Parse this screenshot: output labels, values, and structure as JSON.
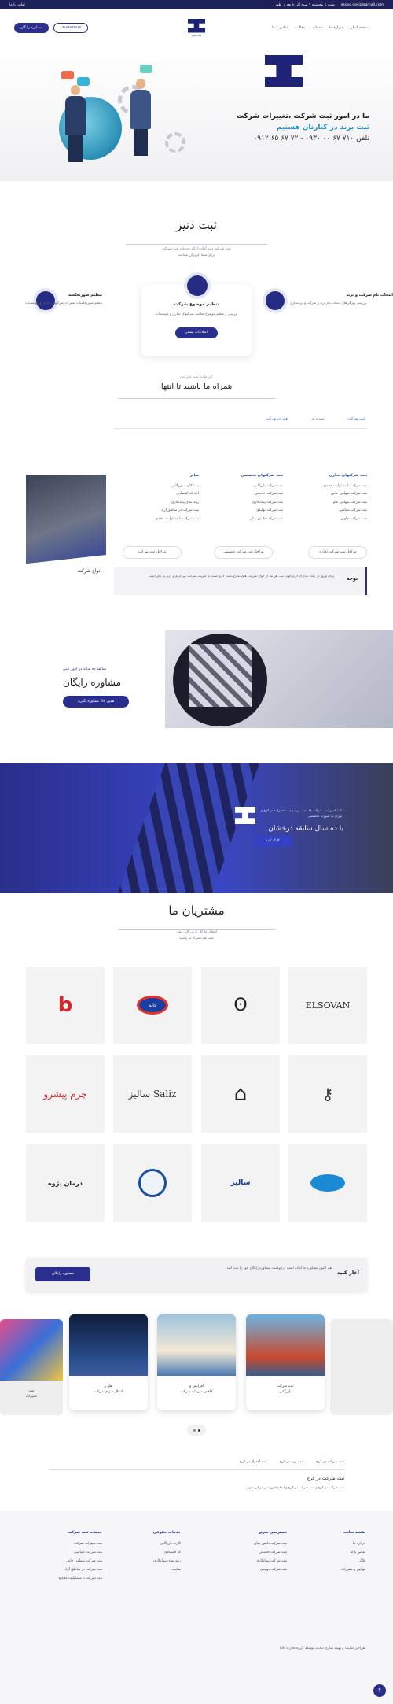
{
  "topbar": {
    "email": "asoyo.desiz@gmail.com",
    "hours": "شنبه تا پنجشنبه ۹ صبح الی ۸ بعد از ظهر",
    "link": "تماس با ما"
  },
  "header": {
    "nav": [
      "صفحه اصلی",
      "درباره ما",
      "خدمات",
      "مقالات",
      "تماس با ما"
    ],
    "logo_text": "ثبت دنیز",
    "phone": "۰۹۱۲۲۷۴۹۲۱۲",
    "consult_btn": "مشاوره رایگان"
  },
  "hero": {
    "line1": "ما در امور ثبت شرکت ،تغییرات شرکت",
    "line2": "ثبت برند در کنارتان هستیم",
    "line3": "تلفن ۷۱۰ ۶۷ ۰۰ ۰۹۳۰ - ۷۲ ۶۷ ۶۵ ۰۹۱۲"
  },
  "about": {
    "title": "ثبت دنیز",
    "sub1": "ثبت شرکت دنیز آماده ارائه خدمات ثبت شرکت",
    "sub2": "برای شما عزیزان میباشد",
    "cards": [
      {
        "title": "انتخاب نام شرکت و برند",
        "text": "بررسی ویژگی‌های انتخاب نام برند و شرکت و برندسازی"
      },
      {
        "title": "تنظیم موضوع شرکت",
        "text": "بررسی و تنظیم موضوع فعالیت شرکتهای تجاری و موسسات"
      },
      {
        "title": "تنظیم صورتجلسه",
        "text": "تنظیم صورتجلسات تغییرات شرکتهای تجاری و موسسات"
      }
    ],
    "more_btn": "اطلاعات بیشتر"
  },
  "services": {
    "kicker": "الزامات ثبت شرکت",
    "title": "همراه ما باشید تا انتها",
    "tabs": [
      "ثبت شرکت",
      "ثبت برند",
      "تغییرات شرکت"
    ],
    "cols": [
      {
        "head": "ثبت شرکتهای تجاری",
        "items": [
          "ثبت شرکت با مسئولیت محدود",
          "ثبت شرکت سهامی خاص",
          "ثبت شرکت سهامی عام",
          "ثبت شرکت تضامنی",
          "ثبت شرکت تعاونی"
        ]
      },
      {
        "head": "ثبت شرکتهای تخصصی",
        "items": [
          "ثبت شرکت بازرگانی",
          "ثبت شرکت خدماتی",
          "ثبت شرکت پیمانکاری",
          "ثبت شرکت تولیدی",
          "ثبت شرکت دانش بنیان"
        ]
      },
      {
        "head": "سایر",
        "items": [
          "ثبت کارت بازرگانی",
          "اخذ کد اقتصادی",
          "رتبه بندی پیمانکاری",
          "ثبت شرکت در مناطق آزاد",
          "ثبت شرکت با مسئولیت محدود"
        ]
      }
    ],
    "pills": [
      "مراحل ثبت شرکت تجاری",
      "مراحل ثبت شرکت تخصصی",
      "مراحل ثبت شرکت"
    ],
    "side_title": "انواع شرکت",
    "note_label": "توجه",
    "note_text": "برای ورود در بحث مدارک لازم جهت ثبت هر یک از انواع شرکت های تجاری،ابتدا لازم است به تعریف شرکت بپردازیم و لازم به ذکر است"
  },
  "consult": {
    "kicker": "سابقه ده ساله در امور ثبتی",
    "title": "مشاوره رایگان",
    "btn": "همین حالا مشاوره بگیرید"
  },
  "banner": {
    "small": "کلیه امور ثبت شرکت ها ، ثبت برند و ثبت تغییرات در کرج و تهران به صورت تخصصی",
    "title": "با ده سال سابقه درخشان",
    "btn": "کلیک کنید"
  },
  "clients": {
    "title": "مشتریان ما",
    "sub1": "افتخار ما کار با بزرگانی مثل",
    "sub2": "شما هم همراه ما باشید",
    "logos": [
      "ELSOVAN",
      "",
      "کاله",
      "",
      "",
      "",
      "Saliz سالیز",
      "چرم پیشرو",
      "",
      "سالیز",
      "",
      "درمان پژوه"
    ]
  },
  "cta": {
    "label": "آغاز کنید",
    "text": "هم اکنون مشاوره ما آماده است درخواست مشاوره رایگان خود را ثبت کنید",
    "btn": "مشاوره رایگان"
  },
  "blog": {
    "cards": [
      {
        "t1": "ثبت شرکت",
        "t2": "بازرگانی"
      },
      {
        "t1": "افزایش و",
        "t2": "کاهش سرمایه شرکت"
      },
      {
        "t1": "نقل و",
        "t2": "انتقال سهام شرکت"
      },
      {
        "t1": "ثبت",
        "t2": "تغییرات"
      }
    ]
  },
  "faq": {
    "tabs": [
      "ثبت شرکت در کرج",
      "ثبت برند در کرج",
      "ثبت اختراع در کرج"
    ],
    "title": "ثبت شرکت در کرج",
    "text": "ثبت شرکت در کرج و ثبت شرکت در کرج و انجام امور ثبتی در این شهر"
  },
  "footer": {
    "cols": [
      {
        "head": "خدمات ثبت شرکت",
        "items": [
          "ثبت تغییرات شرکت",
          "ثبت شرکت تضامنی",
          "ثبت شرکت سهامی خاص",
          "ثبت شرکت در مناطق آزاد",
          "ثبت شرکت با مسئولیت محدود"
        ]
      },
      {
        "head": "خدمات حقوقی",
        "items": [
          "کارت بازرگانی",
          "کد اقتصادی",
          "رتبه بندی پیمانکاری",
          "ساینات"
        ]
      },
      {
        "head": "دسترسی سریع",
        "items": [
          "ثبت شرکت دانش بنیان",
          "ثبت شرکت خدماتی",
          "ثبت شرکت پیمانکاری",
          "ثبت شرکت تولیدی"
        ]
      },
      {
        "head": "نقشه سایت",
        "items": [
          "درباره ما",
          "تماس با ما",
          "بلاگ",
          "قوانین و مقررات"
        ]
      }
    ],
    "copyright": "طراحی سایت و بهینه سازی سایت توسط گروه تجارت تالیا"
  }
}
